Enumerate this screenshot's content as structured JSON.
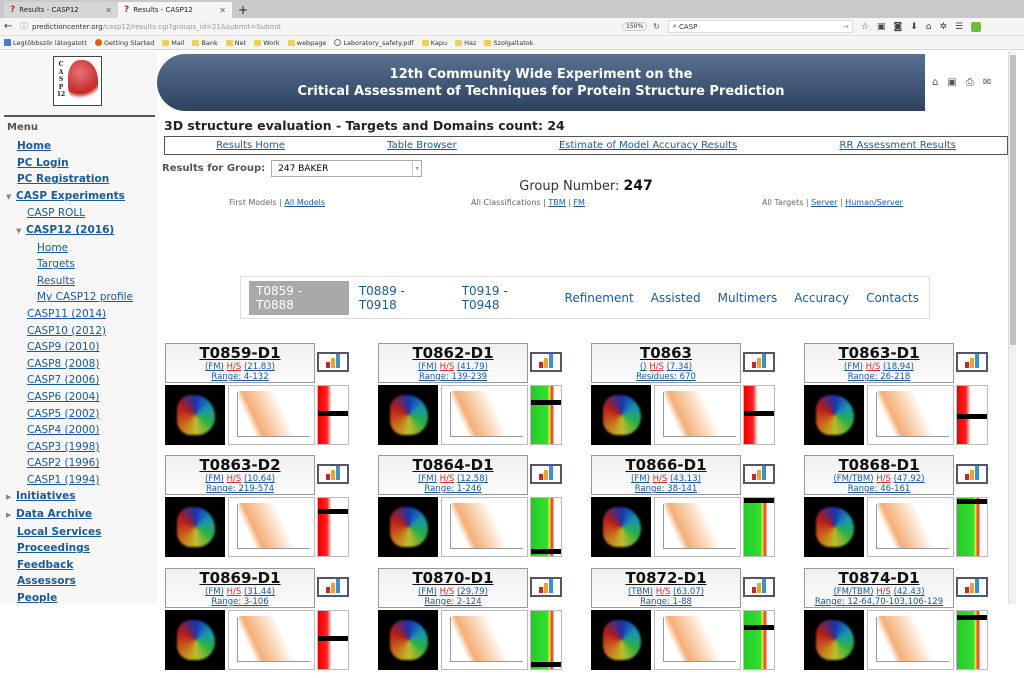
{
  "browser": {
    "tabs": [
      {
        "title": "Results - CASP12",
        "active": false
      },
      {
        "title": "Results - CASP12",
        "active": true
      }
    ],
    "new_tab": "+",
    "url_host": "predictioncenter.org",
    "url_path": "/casp12/results.cgi?groups_id=21&submit=Submit",
    "zoom": "150%",
    "search_value": "CASP",
    "bookmarks": [
      "Legtöbbször látogatott",
      "Getting Started",
      "Mail",
      "Bank",
      "Net",
      "Work",
      "webpage",
      "Laboratory_safety.pdf",
      "Kapu",
      "Haz",
      "Szolgaltatok"
    ]
  },
  "sidebar": {
    "logo_letters": [
      "C",
      "A",
      "S",
      "P",
      "12"
    ],
    "menu_title": "Menu",
    "items": [
      {
        "label": "Home",
        "level": 0
      },
      {
        "label": "PC Login",
        "level": 0
      },
      {
        "label": "PC Registration",
        "level": 0
      },
      {
        "label": "CASP Experiments",
        "level": 0,
        "expanded": true
      },
      {
        "label": "CASP ROLL",
        "level": 1
      },
      {
        "label": "CASP12 (2016)",
        "level": 1,
        "expanded": true
      },
      {
        "label": "Home",
        "level": 2
      },
      {
        "label": "Targets",
        "level": 2
      },
      {
        "label": "Results",
        "level": 2
      },
      {
        "label": "My CASP12 profile",
        "level": 2
      },
      {
        "label": "CASP11 (2014)",
        "level": 1
      },
      {
        "label": "CASP10 (2012)",
        "level": 1
      },
      {
        "label": "CASP9 (2010)",
        "level": 1
      },
      {
        "label": "CASP8 (2008)",
        "level": 1
      },
      {
        "label": "CASP7 (2006)",
        "level": 1
      },
      {
        "label": "CASP6 (2004)",
        "level": 1
      },
      {
        "label": "CASP5 (2002)",
        "level": 1
      },
      {
        "label": "CASP4 (2000)",
        "level": 1
      },
      {
        "label": "CASP3 (1998)",
        "level": 1
      },
      {
        "label": "CASP2 (1996)",
        "level": 1
      },
      {
        "label": "CASP1 (1994)",
        "level": 1
      },
      {
        "label": "Initiatives",
        "level": 0,
        "collapsed": true
      },
      {
        "label": "Data Archive",
        "level": 0,
        "collapsed": true
      },
      {
        "label": "Local Services",
        "level": 0
      },
      {
        "label": "Proceedings",
        "level": 0
      },
      {
        "label": "Feedback",
        "level": 0
      },
      {
        "label": "Assessors",
        "level": 0
      },
      {
        "label": "People",
        "level": 0
      }
    ]
  },
  "header": {
    "line1": "12th Community Wide Experiment on the",
    "line2": "Critical Assessment of Techniques for Protein Structure Prediction",
    "icons": [
      "home-icon",
      "folder-icon",
      "print-icon",
      "mail-icon"
    ]
  },
  "main": {
    "title": "3D structure evaluation - Targets and Domains count: 24",
    "links": [
      "Results Home",
      "Table Browser",
      "Estimate of Model Accuracy Results",
      "RR Assessment Results"
    ],
    "group_label": "Results for Group:",
    "group_selected": "247 BAKER",
    "group_number_label": "Group Number:",
    "group_number": "247",
    "filters": {
      "models": {
        "current": "First Models",
        "link": "All Models"
      },
      "classifications": {
        "current": "All Classifications",
        "links": [
          "TBM",
          "FM"
        ]
      },
      "targets": {
        "current": "All Targets",
        "links": [
          "Server",
          "Human/Server"
        ]
      }
    },
    "tabs": [
      {
        "label": "T0859 - T0888",
        "active": true
      },
      {
        "label": "T0889 - T0918"
      },
      {
        "label": "T0919 - T0948"
      },
      {
        "label": "Refinement"
      },
      {
        "label": "Assisted"
      },
      {
        "label": "Multimers"
      },
      {
        "label": "Accuracy"
      },
      {
        "label": "Contacts"
      }
    ],
    "targets": [
      {
        "name": "T0859-D1",
        "class": "(FM)",
        "hs": "H/S",
        "score": "(21.83)",
        "range": "Range: 4-132"
      },
      {
        "name": "T0862-D1",
        "class": "(FM)",
        "hs": "H/S",
        "score": "(41.79)",
        "range": "Range: 139-239"
      },
      {
        "name": "T0863",
        "class": "()",
        "hs": "H/S",
        "score": "(7.34)",
        "range": "Residues: 670"
      },
      {
        "name": "T0863-D1",
        "class": "(FM)",
        "hs": "H/S",
        "score": "(18.94)",
        "range": "Range: 26-218"
      },
      {
        "name": "T0863-D2",
        "class": "(FM)",
        "hs": "H/S",
        "score": "(10.64)",
        "range": "Range: 219-574"
      },
      {
        "name": "T0864-D1",
        "class": "(FM)",
        "hs": "H/S",
        "score": "(12.58)",
        "range": "Range: 1-246"
      },
      {
        "name": "T0866-D1",
        "class": "(FM)",
        "hs": "H/S",
        "score": "(43.13)",
        "range": "Range: 38-141"
      },
      {
        "name": "T0868-D1",
        "class": "(FM/TBM)",
        "hs": "H/S",
        "score": "(47.92)",
        "range": "Range: 46-161"
      },
      {
        "name": "T0869-D1",
        "class": "(FM)",
        "hs": "H/S",
        "score": "(31.44)",
        "range": "Range: 3-106"
      },
      {
        "name": "T0870-D1",
        "class": "(FM)",
        "hs": "H/S",
        "score": "(29.79)",
        "range": "Range: 2-124"
      },
      {
        "name": "T0872-D1",
        "class": "(TBM)",
        "hs": "H/S",
        "score": "(63.07)",
        "range": "Range: 1-88"
      },
      {
        "name": "T0874-D1",
        "class": "(FM/TBM)",
        "hs": "H/S",
        "score": "(42.43)",
        "range": "Range: 12-64,70-103,106-129"
      }
    ]
  }
}
